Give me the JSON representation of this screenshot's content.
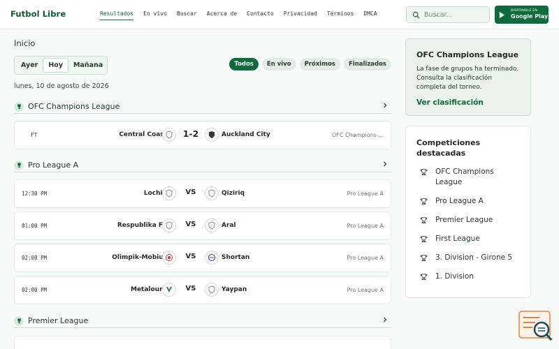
{
  "header": {
    "logo": "Futbol Libre",
    "nav": [
      {
        "label": "Resultados",
        "active": true
      },
      {
        "label": "En vivo"
      },
      {
        "label": "Buscar"
      },
      {
        "label": "Acerca de"
      },
      {
        "label": "Contacto"
      },
      {
        "label": "Privacidad"
      },
      {
        "label": "Términos"
      },
      {
        "label": "DMCA"
      }
    ],
    "search_placeholder": "Buscar...",
    "gplay_small": "DISPONIBLE EN",
    "gplay_big": "Google Play"
  },
  "main": {
    "breadcrumb": "Inicio",
    "days": [
      "Ayer",
      "Hoy",
      "Mañana"
    ],
    "active_day": "Hoy",
    "filters": [
      "Todos",
      "En vivo",
      "Próximos",
      "Finalizados"
    ],
    "active_filter": "Todos",
    "date": "lunes, 10 de agosto de 2026",
    "leagues": [
      {
        "name": "OFC Champions League",
        "matches": [
          {
            "status": "FT",
            "home": "Central Coast",
            "score": "1-2",
            "away": "Auckland City",
            "competition": "OFC Champions ..."
          }
        ]
      },
      {
        "name": "Pro League A",
        "matches": [
          {
            "time": "12:30 PM",
            "home": "Lochin",
            "mid": "VS",
            "away": "Qiziriq",
            "competition": "Pro League A"
          },
          {
            "time": "01:00 PM",
            "home": "Respublika FA",
            "mid": "VS",
            "away": "Aral",
            "competition": "Pro League A"
          },
          {
            "time": "02:00 PM",
            "home": "Olimpik-Mobiuz",
            "mid": "VS",
            "away": "Shortan",
            "competition": "Pro League A"
          },
          {
            "time": "02:00 PM",
            "home": "Metalourg",
            "mid": "VS",
            "away": "Yaypan",
            "competition": "Pro League A"
          }
        ]
      },
      {
        "name": "Premier League",
        "matches": []
      }
    ]
  },
  "sidebar": {
    "promo": {
      "title": "OFC Champions League",
      "text": "La fase de grupos ha terminado. Consulta la clasificación completa del torneo.",
      "link": "Ver clasificación"
    },
    "featured": {
      "title": "Competiciones destacadas",
      "items": [
        "OFC Champions League",
        "Pro League A",
        "Premier League",
        "First League",
        "3. Division - Girone 5",
        "1. Division"
      ]
    }
  },
  "colors": {
    "brand": "#0b6b3a",
    "background": "#f7faf8"
  }
}
